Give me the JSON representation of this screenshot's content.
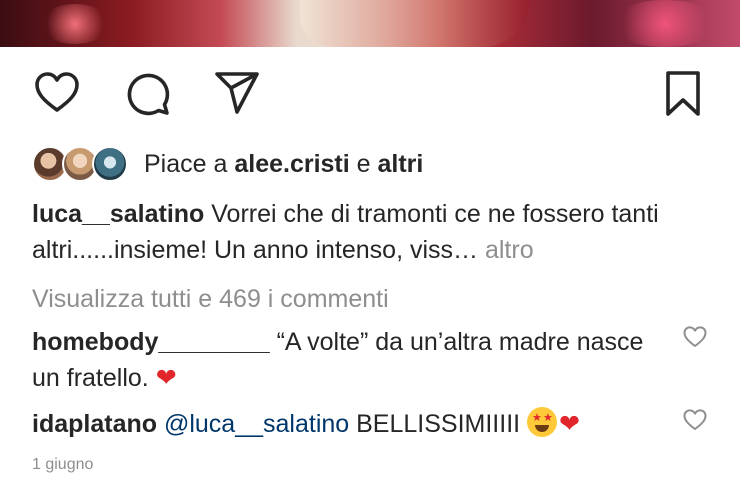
{
  "post": {
    "likes": {
      "prefix": "Piace a ",
      "user": "alee.cristi",
      "joiner": " e ",
      "others": "altri"
    },
    "caption": {
      "user": "luca__salatino",
      "text": " Vorrei che di tramonti ce ne fossero tanti altri......insieme! Un anno intenso, viss… ",
      "more": "altro"
    },
    "view_comments": "Visualizza tutti e 469 i commenti",
    "comments": [
      {
        "user": "homebody________",
        "text": " “A volte” da un’altra madre nasce un fratello. ",
        "emoji": "❤"
      },
      {
        "user": "idaplatano",
        "mention": "@luca__salatino",
        "text": " BELLISSIMIIIII ",
        "emoji_face": "star-struck",
        "emoji": "❤"
      }
    ],
    "date": "1 giugno"
  },
  "icons": {
    "like": "heart-outline-icon",
    "comment": "comment-bubble-icon",
    "share": "paper-plane-icon",
    "save": "bookmark-icon"
  },
  "colors": {
    "text": "#262626",
    "muted": "#8e8e8e",
    "mention": "#00376b",
    "heart": "#e0262b"
  }
}
